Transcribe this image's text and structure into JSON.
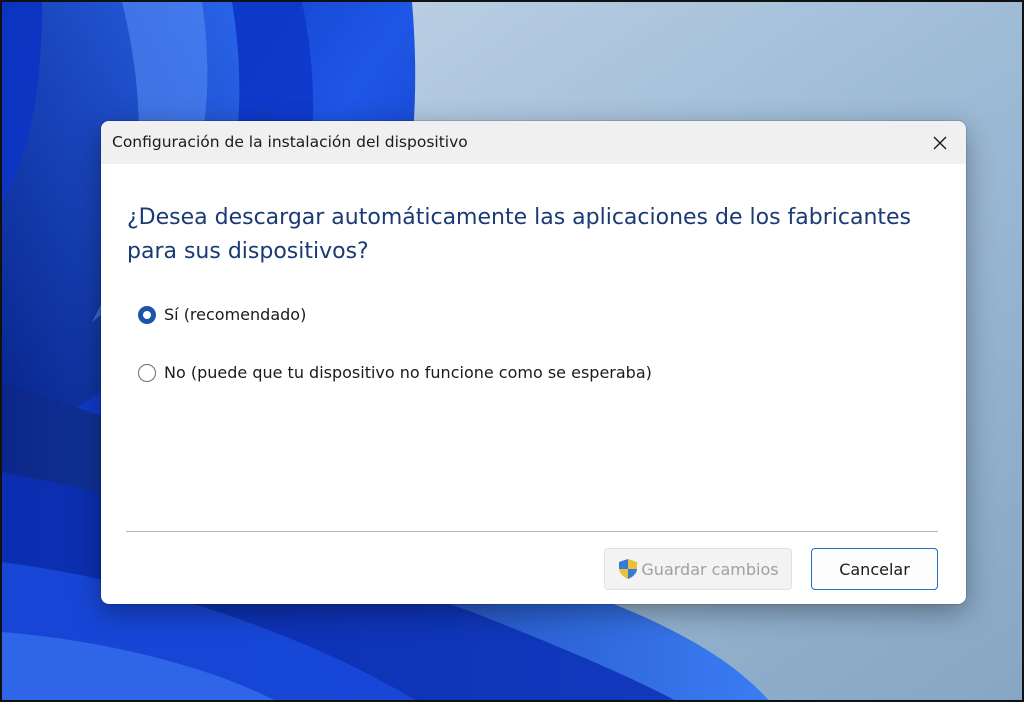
{
  "dialog": {
    "title": "Configuración de la instalación del dispositivo",
    "question": "¿Desea descargar automáticamente las aplicaciones de los fabricantes para sus dispositivos?",
    "options": [
      {
        "label": "Sí (recomendado)",
        "selected": true
      },
      {
        "label": "No (puede que tu dispositivo no funcione como se esperaba)",
        "selected": false
      }
    ],
    "save_label": "Guardar cambios",
    "cancel_label": "Cancelar",
    "save_enabled": false
  },
  "colors": {
    "accent": "#1a55a8",
    "heading": "#1a3a75",
    "cancel_border": "#1f6fc7"
  },
  "icons": {
    "close": "close-icon",
    "shield": "uac-shield-icon"
  }
}
